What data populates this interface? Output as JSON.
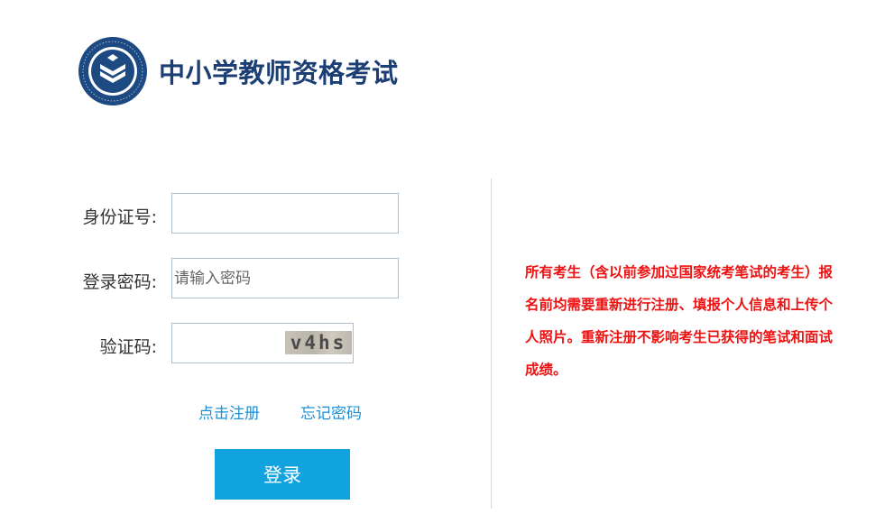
{
  "header": {
    "title": "中小学教师资格考试",
    "logo_icon": "exam-emblem-icon",
    "brand_color": "#1b3f75"
  },
  "form": {
    "id_label": "身份证号:",
    "id_value": "",
    "password_label": "登录密码:",
    "password_placeholder": "请输入密码",
    "captcha_label": "验证码:",
    "captcha_value": "",
    "captcha_text": "v4hs"
  },
  "links": {
    "register": "点击注册",
    "forgot_password": "忘记密码"
  },
  "login_button": "登录",
  "notice": {
    "text": "所有考生（含以前参加过国家统考笔试的考生）报名前均需要重新进行注册、填报个人信息和上传个人照片。重新注册不影响考生已获得的笔试和面试成绩。",
    "color": "#ee1111"
  },
  "colors": {
    "accent": "#11a3e0",
    "link": "#1e8fd4"
  }
}
